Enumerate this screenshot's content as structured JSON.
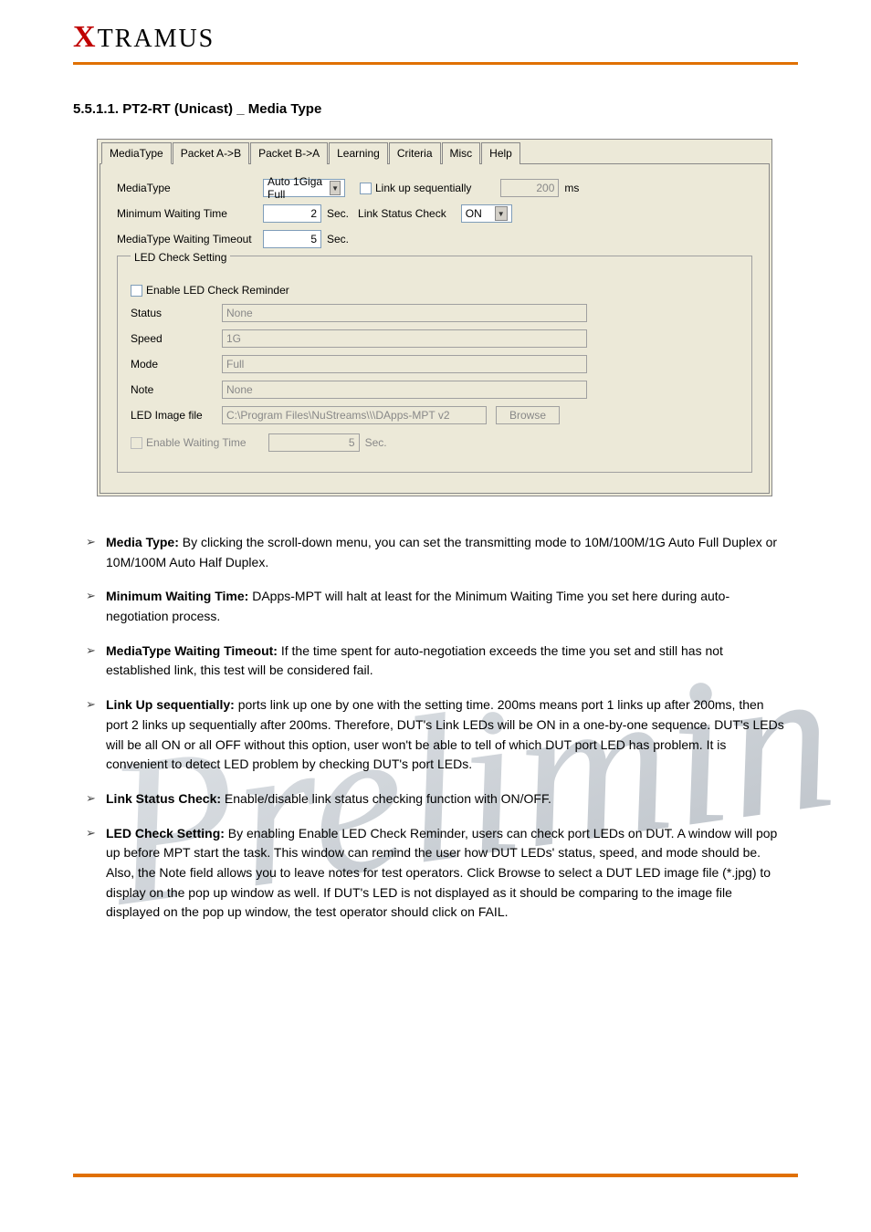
{
  "header": {
    "logo_prefix": "X",
    "logo_rest": "TRAMUS"
  },
  "section_title": "5.5.1.1. PT2-RT (Unicast) _ Media Type",
  "tabs": [
    {
      "label": "MediaType",
      "active": true
    },
    {
      "label": "Packet A->B",
      "active": false
    },
    {
      "label": "Packet B->A",
      "active": false
    },
    {
      "label": "Learning",
      "active": false
    },
    {
      "label": "Criteria",
      "active": false
    },
    {
      "label": "Misc",
      "active": false
    },
    {
      "label": "Help",
      "active": false
    }
  ],
  "form": {
    "mediaType": {
      "label": "MediaType",
      "value": "Auto 1Giga Full"
    },
    "linkUpSequentially": {
      "label": "Link up sequentially",
      "value": "200",
      "unit": "ms"
    },
    "minWaiting": {
      "label": "Minimum Waiting Time",
      "value": "2",
      "unit": "Sec."
    },
    "linkStatusCheck": {
      "label": "Link Status Check",
      "value": "ON"
    },
    "mediaTypeTimeout": {
      "label": "MediaType Waiting Timeout",
      "value": "5",
      "unit": "Sec."
    },
    "ledLegend": "LED Check Setting",
    "enableLedReminder": {
      "label": "Enable LED Check Reminder"
    },
    "status": {
      "label": "Status",
      "value": "None"
    },
    "speed": {
      "label": "Speed",
      "value": "1G"
    },
    "mode": {
      "label": "Mode",
      "value": "Full"
    },
    "note": {
      "label": "Note",
      "value": "None"
    },
    "ledImageFile": {
      "label": "LED Image file",
      "value": "C:\\Program Files\\NuStreams\\\\\\DApps-MPT v2"
    },
    "browse": "Browse",
    "enableWait": {
      "label": "Enable Waiting Time",
      "value": "5",
      "unit": "Sec."
    }
  },
  "bullets": [
    {
      "strong": "Media Type:",
      "rest": " By clicking the scroll-down menu, you can set the transmitting mode to 10M/100M/1G Auto Full Duplex or 10M/100M Auto Half Duplex."
    },
    {
      "strong": "Minimum Waiting Time:",
      "rest": " DApps-MPT will halt at least for the Minimum Waiting Time you set here during auto-negotiation process."
    },
    {
      "strong": "MediaType Waiting Timeout:",
      "rest": " If the time spent for auto-negotiation exceeds the time you set and still has not established link, this test will be considered fail."
    },
    {
      "strong": "Link Up sequentially:",
      "rest": " ports link up one by one with the setting time. 200ms means port 1 links up after 200ms, then port 2 links up sequentially after 200ms. Therefore, DUT's Link LEDs will be ON in a one-by-one sequence. DUT's LEDs will be all ON or all OFF without this option, user won't be able to tell of which DUT port LED has problem. It is convenient to detect LED problem by checking DUT's port LEDs."
    },
    {
      "strong": "Link Status Check:",
      "rest": " Enable/disable link status checking function with ON/OFF."
    },
    {
      "strong": "LED Check Setting:",
      "rest": " By enabling Enable LED Check Reminder, users can check port LEDs on DUT. A window will pop up before MPT start the task. This window can remind the user how DUT LEDs' status, speed, and mode should be. Also, the Note field allows you to leave notes for test operators. Click Browse to select a DUT LED image file (*.jpg) to display on the pop up window as well. If DUT's LED is not displayed as it should be comparing to the image file displayed on the pop up window, the test operator should click on FAIL."
    }
  ]
}
